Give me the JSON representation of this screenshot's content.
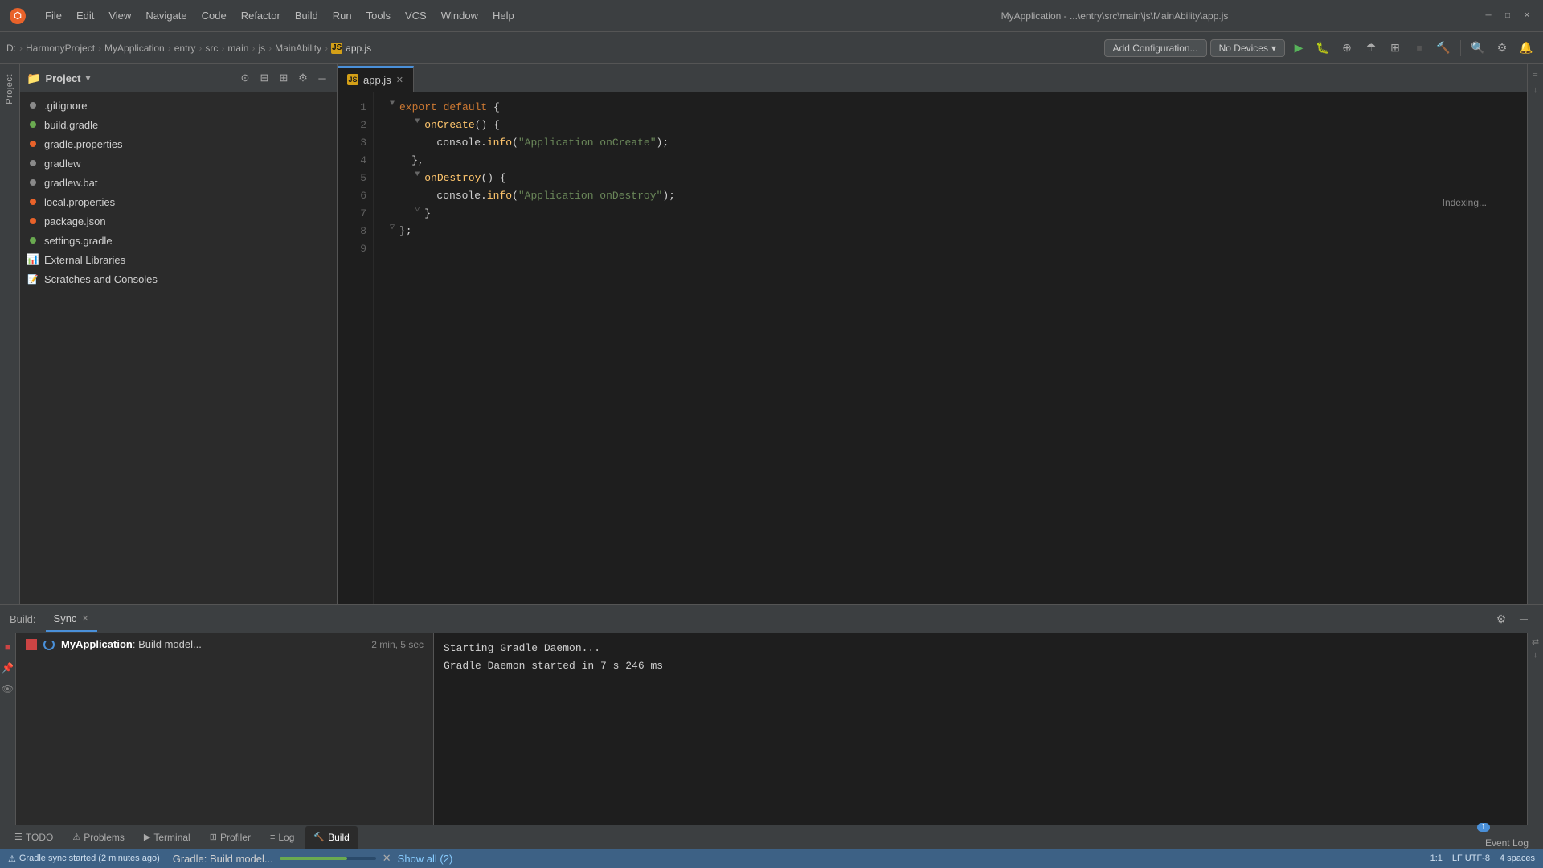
{
  "titlebar": {
    "title": "MyApplication - ...\\entry\\src\\main\\js\\MainAbility\\app.js",
    "menu": [
      "File",
      "Edit",
      "View",
      "Navigate",
      "Code",
      "Refactor",
      "Build",
      "Run",
      "Tools",
      "VCS",
      "Window",
      "Help"
    ]
  },
  "toolbar": {
    "breadcrumb": [
      "D:",
      "HarmonyProject",
      "MyApplication",
      "entry",
      "src",
      "main",
      "js",
      "MainAbility",
      "app.js"
    ],
    "add_config_label": "Add Configuration...",
    "no_devices_label": "No Devices",
    "indexing_label": "Indexing..."
  },
  "project": {
    "title": "Project",
    "dropdown_arrow": "▾",
    "files": [
      {
        "name": ".gitignore",
        "type": "file",
        "color": "gray"
      },
      {
        "name": "build.gradle",
        "type": "file",
        "color": "green"
      },
      {
        "name": "gradle.properties",
        "type": "file",
        "color": "orange"
      },
      {
        "name": "gradlew",
        "type": "file",
        "color": "gray"
      },
      {
        "name": "gradlew.bat",
        "type": "file",
        "color": "gray"
      },
      {
        "name": "local.properties",
        "type": "file",
        "color": "orange"
      },
      {
        "name": "package.json",
        "type": "file",
        "color": "orange"
      },
      {
        "name": "settings.gradle",
        "type": "file",
        "color": "green"
      },
      {
        "name": "External Libraries",
        "type": "folder",
        "color": "orange"
      },
      {
        "name": "Scratches and Consoles",
        "type": "special",
        "color": "orange"
      }
    ]
  },
  "editor": {
    "tab_name": "app.js",
    "lines": [
      {
        "num": "1",
        "content": "export_default_open"
      },
      {
        "num": "2",
        "content": "onCreate"
      },
      {
        "num": "3",
        "content": "console_oncreate"
      },
      {
        "num": "4",
        "content": "close_brace_comma"
      },
      {
        "num": "5",
        "content": "onDestroy"
      },
      {
        "num": "6",
        "content": "console_ondestroy"
      },
      {
        "num": "7",
        "content": "close_brace"
      },
      {
        "num": "8",
        "content": "close_semi"
      },
      {
        "num": "9",
        "content": ""
      }
    ]
  },
  "bottom_panel": {
    "build_label": "Build:",
    "sync_tab": "Sync",
    "build_item": {
      "name": "MyApplication",
      "task": "Build model...",
      "time": "2 min, 5 sec"
    },
    "log_lines": [
      "Starting Gradle Daemon...",
      "Gradle Daemon started in 7 s 246 ms"
    ]
  },
  "bottom_tabs": [
    {
      "label": "TODO",
      "icon": "☰",
      "active": false
    },
    {
      "label": "Problems",
      "icon": "⚠",
      "active": false
    },
    {
      "label": "Terminal",
      "icon": "▶",
      "active": false
    },
    {
      "label": "Profiler",
      "icon": "📊",
      "active": false
    },
    {
      "label": "Log",
      "icon": "📋",
      "active": false
    },
    {
      "label": "Build",
      "icon": "🔨",
      "active": true
    }
  ],
  "status_bar": {
    "left_text": "Gradle sync started (2 minutes ago)",
    "gradle_text": "Gradle: Build model...",
    "show_all": "Show all (2)",
    "position": "1:1",
    "encoding": "LF  UTF-8",
    "indent": "4 spaces",
    "event_log": "Event Log",
    "event_count": "1"
  }
}
